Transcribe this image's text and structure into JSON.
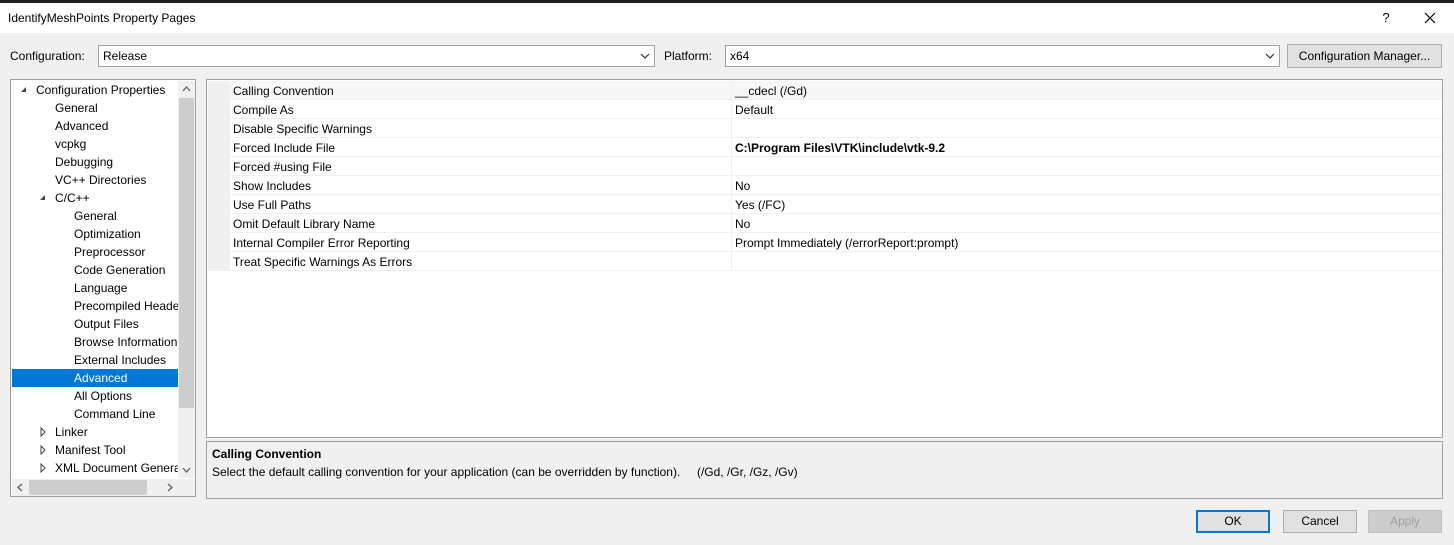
{
  "window": {
    "title": "IdentifyMeshPoints Property Pages",
    "help_label": "?"
  },
  "config_bar": {
    "configuration_label": "Configuration:",
    "configuration_value": "Release",
    "platform_label": "Platform:",
    "platform_value": "x64",
    "config_manager_label": "Configuration Manager..."
  },
  "tree": {
    "items": [
      {
        "label": "Configuration Properties",
        "expander": "expanded"
      },
      {
        "label": "General"
      },
      {
        "label": "Advanced"
      },
      {
        "label": "vcpkg"
      },
      {
        "label": "Debugging"
      },
      {
        "label": "VC++ Directories"
      },
      {
        "label": "C/C++",
        "expander": "expanded"
      },
      {
        "label": "General"
      },
      {
        "label": "Optimization"
      },
      {
        "label": "Preprocessor"
      },
      {
        "label": "Code Generation"
      },
      {
        "label": "Language"
      },
      {
        "label": "Precompiled Heade"
      },
      {
        "label": "Output Files"
      },
      {
        "label": "Browse Information"
      },
      {
        "label": "External Includes"
      },
      {
        "label": "Advanced",
        "selected": true
      },
      {
        "label": "All Options"
      },
      {
        "label": "Command Line"
      },
      {
        "label": "Linker",
        "expander": "collapsed"
      },
      {
        "label": "Manifest Tool",
        "expander": "collapsed"
      },
      {
        "label": "XML Document Genera",
        "expander": "collapsed"
      }
    ]
  },
  "grid": {
    "rows": [
      {
        "name": "Calling Convention",
        "value": "__cdecl (/Gd)"
      },
      {
        "name": "Compile As",
        "value": "Default"
      },
      {
        "name": "Disable Specific Warnings",
        "value": ""
      },
      {
        "name": "Forced Include File",
        "value": "C:\\Program Files\\VTK\\include\\vtk-9.2",
        "bold": true
      },
      {
        "name": "Forced #using File",
        "value": ""
      },
      {
        "name": "Show Includes",
        "value": "No"
      },
      {
        "name": "Use Full Paths",
        "value": "Yes (/FC)"
      },
      {
        "name": "Omit Default Library Name",
        "value": "No"
      },
      {
        "name": "Internal Compiler Error Reporting",
        "value": "Prompt Immediately (/errorReport:prompt)"
      },
      {
        "name": "Treat Specific Warnings As Errors",
        "value": ""
      }
    ]
  },
  "description": {
    "title": "Calling Convention",
    "text": "Select the default calling convention for your application (can be overridden by function).     (/Gd, /Gr, /Gz, /Gv)"
  },
  "buttons": {
    "ok": "OK",
    "cancel": "Cancel",
    "apply": "Apply"
  },
  "colors": {
    "selection": "#0078d7",
    "window_bg": "#f0f0f0"
  }
}
